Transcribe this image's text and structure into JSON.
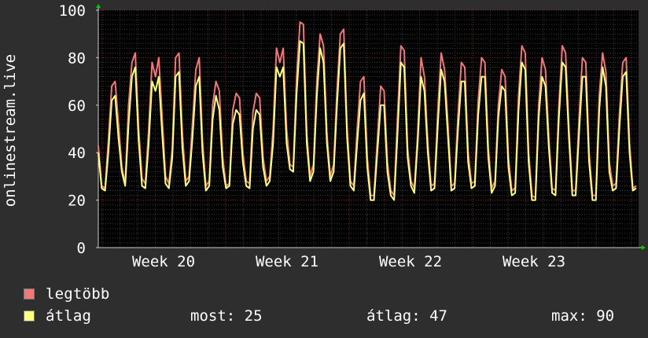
{
  "chart_data": {
    "type": "line",
    "ylabel": "onlinestream.live",
    "ylim": [
      0,
      100
    ],
    "yticks": [
      "0",
      "20",
      "40",
      "60",
      "80",
      "100"
    ],
    "xticks": [
      "Week 20",
      "Week 21",
      "Week 22",
      "Week 23"
    ],
    "background": "#000000",
    "frame_bg": "#2e2e2e",
    "grid": true,
    "legend_position": "bottom-left",
    "series": [
      {
        "name": "legtöbb",
        "color": "#f07878",
        "values": [
          43,
          26,
          25,
          45,
          68,
          70,
          52,
          34,
          27,
          60,
          78,
          82,
          50,
          29,
          27,
          50,
          78,
          72,
          80,
          55,
          30,
          27,
          42,
          80,
          82,
          48,
          28,
          30,
          52,
          75,
          80,
          45,
          26,
          28,
          60,
          70,
          66,
          38,
          26,
          27,
          58,
          65,
          63,
          40,
          28,
          27,
          57,
          65,
          63,
          38,
          28,
          30,
          50,
          84,
          78,
          84,
          50,
          35,
          34,
          72,
          95,
          94,
          48,
          30,
          35,
          70,
          90,
          85,
          48,
          30,
          35,
          66,
          90,
          92,
          50,
          28,
          26,
          50,
          70,
          72,
          38,
          22,
          22,
          45,
          68,
          66,
          36,
          24,
          22,
          55,
          85,
          83,
          42,
          28,
          25,
          48,
          80,
          72,
          44,
          26,
          27,
          58,
          82,
          75,
          52,
          26,
          27,
          56,
          78,
          76,
          40,
          27,
          28,
          62,
          80,
          78,
          42,
          25,
          28,
          60,
          75,
          72,
          38,
          24,
          25,
          64,
          85,
          82,
          40,
          22,
          21,
          60,
          80,
          75,
          46,
          25,
          24,
          60,
          85,
          82,
          50,
          24,
          24,
          54,
          80,
          78,
          40,
          22,
          22,
          64,
          82,
          74,
          36,
          26,
          27,
          56,
          78,
          80,
          44,
          25,
          26
        ]
      },
      {
        "name": "átlag",
        "color": "#ffff80",
        "values": [
          40,
          25,
          24,
          40,
          62,
          64,
          46,
          32,
          26,
          52,
          72,
          76,
          45,
          26,
          25,
          44,
          70,
          66,
          72,
          48,
          27,
          25,
          38,
          72,
          74,
          42,
          26,
          28,
          46,
          68,
          72,
          40,
          24,
          26,
          54,
          64,
          58,
          34,
          25,
          26,
          52,
          58,
          56,
          36,
          26,
          25,
          50,
          58,
          56,
          34,
          26,
          28,
          44,
          76,
          72,
          76,
          44,
          33,
          32,
          65,
          87,
          86,
          44,
          28,
          32,
          64,
          84,
          78,
          44,
          28,
          32,
          60,
          84,
          86,
          46,
          26,
          24,
          44,
          62,
          65,
          34,
          20,
          20,
          40,
          60,
          60,
          32,
          22,
          20,
          48,
          78,
          76,
          38,
          26,
          23,
          44,
          72,
          66,
          40,
          24,
          25,
          52,
          75,
          70,
          47,
          24,
          25,
          50,
          70,
          70,
          36,
          25,
          26,
          56,
          72,
          72,
          38,
          23,
          26,
          55,
          68,
          66,
          34,
          22,
          23,
          58,
          78,
          75,
          36,
          20,
          20,
          55,
          72,
          68,
          42,
          23,
          22,
          55,
          78,
          76,
          46,
          22,
          22,
          48,
          72,
          72,
          36,
          20,
          20,
          58,
          76,
          68,
          32,
          24,
          25,
          50,
          72,
          74,
          40,
          24,
          25
        ]
      }
    ]
  },
  "legend": {
    "max_label": "legtöbb",
    "avg_label": "átlag",
    "stats": [
      {
        "key": "most:",
        "value": "25"
      },
      {
        "key": "átlag:",
        "value": "47"
      },
      {
        "key": "max:",
        "value": "90"
      }
    ]
  }
}
